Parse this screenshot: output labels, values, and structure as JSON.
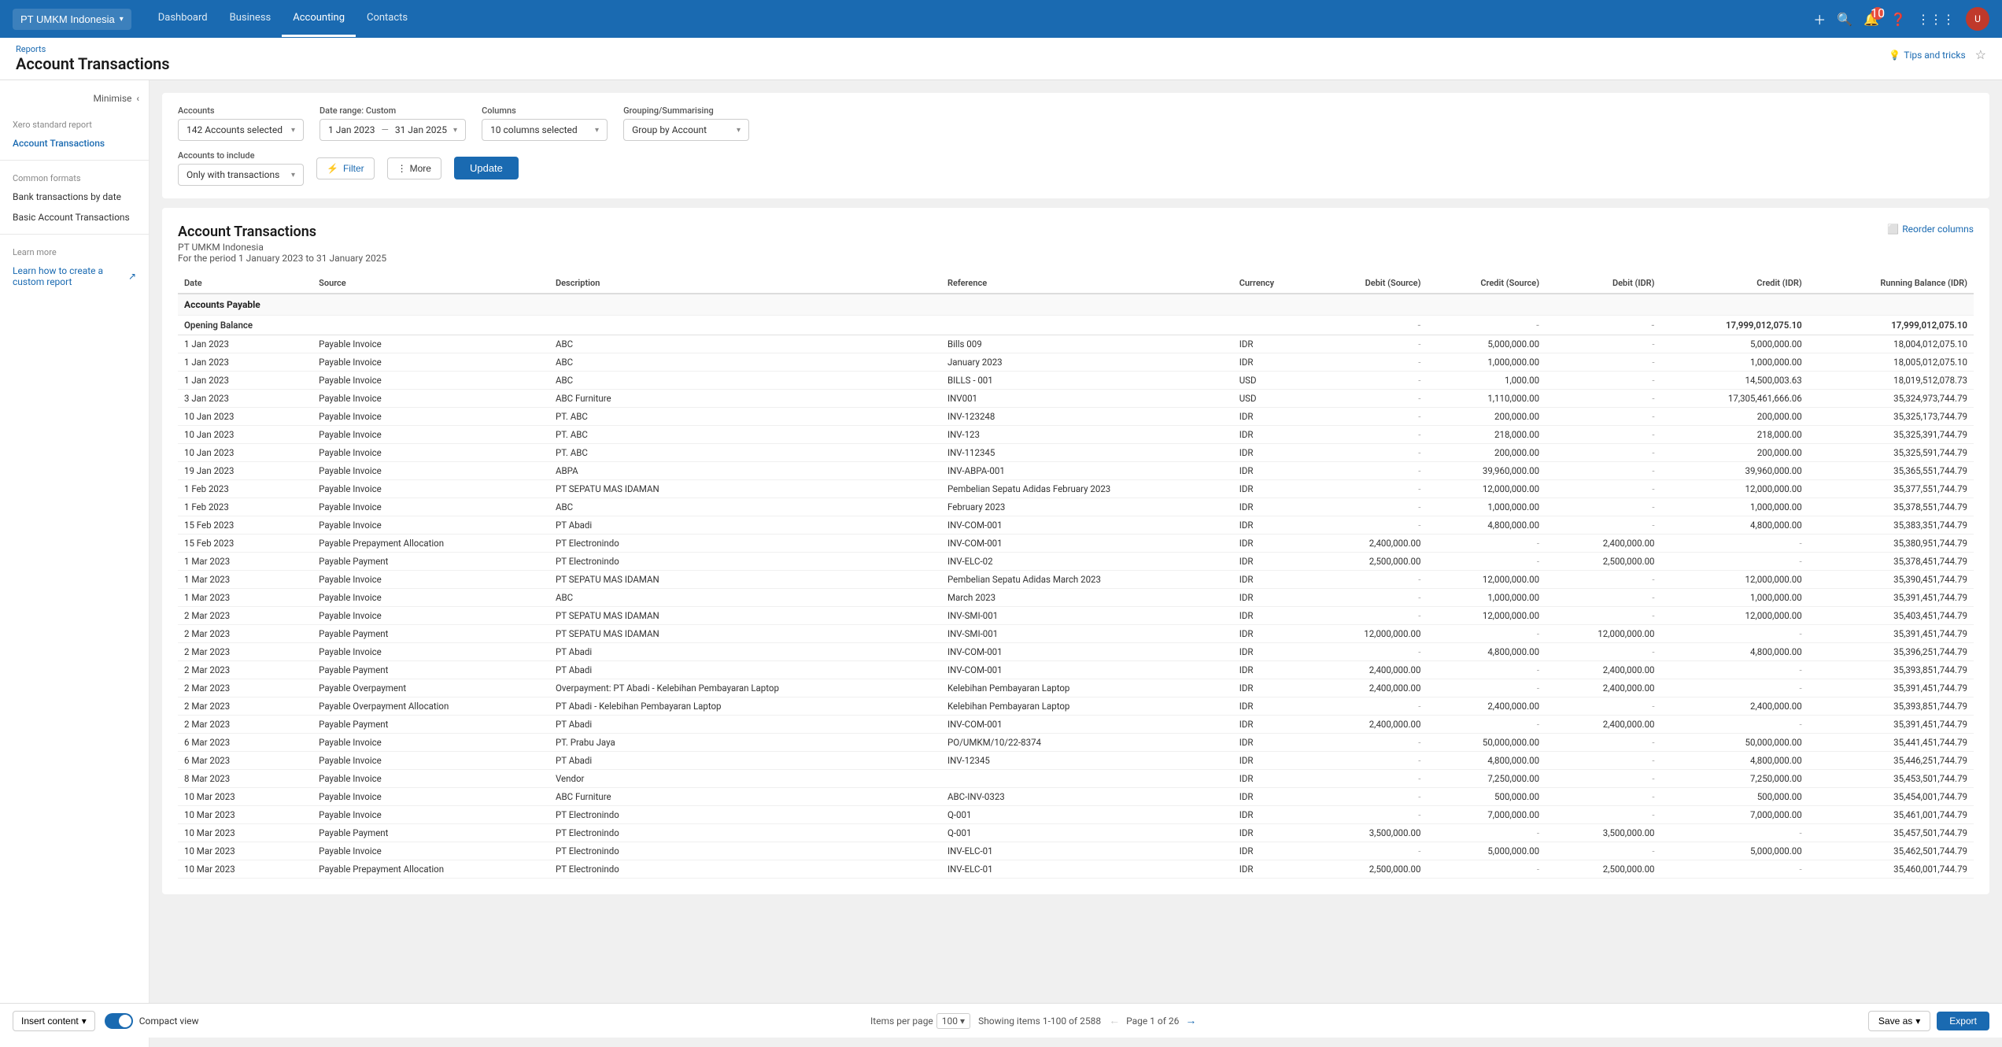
{
  "topNav": {
    "orgName": "PT UMKM Indonesia",
    "navLinks": [
      {
        "label": "Dashboard",
        "active": false
      },
      {
        "label": "Business",
        "active": false
      },
      {
        "label": "Accounting",
        "active": true
      },
      {
        "label": "Contacts",
        "active": false
      }
    ],
    "notificationCount": "10"
  },
  "pageHeader": {
    "breadcrumb": "Reports",
    "title": "Account Transactions",
    "tipsLabel": "Tips and tricks"
  },
  "sidebar": {
    "minimizeLabel": "Minimise",
    "xeroStandardLabel": "Xero standard report",
    "activeReport": "Account Transactions",
    "commonFormatsLabel": "Common formats",
    "commonFormats": [
      {
        "label": "Bank transactions by date"
      },
      {
        "label": "Basic Account Transactions"
      }
    ],
    "learnMoreLabel": "Learn more",
    "learnLink": "Learn how to create a custom report"
  },
  "filters": {
    "accountsLabel": "Accounts",
    "accountsValue": "142 Accounts selected",
    "dateRangeLabel": "Date range: Custom",
    "dateFrom": "1 Jan 2023",
    "dateTo": "31 Jan 2025",
    "columnsLabel": "Columns",
    "columnsValue": "10 columns selected",
    "groupingLabel": "Grouping/Summarising",
    "groupingValue": "Group by Account",
    "accountsToIncludeLabel": "Accounts to include",
    "includeValue": "Only with transactions",
    "filterBtnLabel": "Filter",
    "moreBtnLabel": "More",
    "updateBtnLabel": "Update"
  },
  "report": {
    "title": "Account Transactions",
    "company": "PT UMKM Indonesia",
    "periodLabel": "For the period 1 January 2023 to 31 January 2025",
    "reorderLabel": "Reorder columns",
    "columns": [
      "Date",
      "Source",
      "Description",
      "Reference",
      "Currency",
      "Debit (Source)",
      "Credit (Source)",
      "Debit (IDR)",
      "Credit (IDR)",
      "Running Balance (IDR)"
    ],
    "sections": [
      {
        "name": "Accounts Payable",
        "subHeaders": [
          "Opening Balance"
        ],
        "openingValues": [
          "-",
          "-",
          "-",
          "17,999,012,075.10",
          "17,999,012,075.10"
        ],
        "rows": [
          [
            "1 Jan 2023",
            "Payable Invoice",
            "ABC",
            "Bills 009",
            "IDR",
            "-",
            "5,000,000.00",
            "-",
            "5,000,000.00",
            "18,004,012,075.10"
          ],
          [
            "1 Jan 2023",
            "Payable Invoice",
            "ABC",
            "January 2023",
            "IDR",
            "-",
            "1,000,000.00",
            "-",
            "1,000,000.00",
            "18,005,012,075.10"
          ],
          [
            "1 Jan 2023",
            "Payable Invoice",
            "ABC",
            "BILLS - 001",
            "USD",
            "-",
            "1,000.00",
            "-",
            "14,500,003.63",
            "18,019,512,078.73"
          ],
          [
            "3 Jan 2023",
            "Payable Invoice",
            "ABC Furniture",
            "INV001",
            "USD",
            "-",
            "1,110,000.00",
            "-",
            "17,305,461,666.06",
            "35,324,973,744.79"
          ],
          [
            "10 Jan 2023",
            "Payable Invoice",
            "PT. ABC",
            "INV-123248",
            "IDR",
            "-",
            "200,000.00",
            "-",
            "200,000.00",
            "35,325,173,744.79"
          ],
          [
            "10 Jan 2023",
            "Payable Invoice",
            "PT. ABC",
            "INV-123",
            "IDR",
            "-",
            "218,000.00",
            "-",
            "218,000.00",
            "35,325,391,744.79"
          ],
          [
            "10 Jan 2023",
            "Payable Invoice",
            "PT. ABC",
            "INV-112345",
            "IDR",
            "-",
            "200,000.00",
            "-",
            "200,000.00",
            "35,325,591,744.79"
          ],
          [
            "19 Jan 2023",
            "Payable Invoice",
            "ABPA",
            "INV-ABPA-001",
            "IDR",
            "-",
            "39,960,000.00",
            "-",
            "39,960,000.00",
            "35,365,551,744.79"
          ],
          [
            "1 Feb 2023",
            "Payable Invoice",
            "PT SEPATU MAS IDAMAN",
            "Pembelian Sepatu Adidas February 2023",
            "IDR",
            "-",
            "12,000,000.00",
            "-",
            "12,000,000.00",
            "35,377,551,744.79"
          ],
          [
            "1 Feb 2023",
            "Payable Invoice",
            "ABC",
            "February 2023",
            "IDR",
            "-",
            "1,000,000.00",
            "-",
            "1,000,000.00",
            "35,378,551,744.79"
          ],
          [
            "15 Feb 2023",
            "Payable Invoice",
            "PT Abadi",
            "INV-COM-001",
            "IDR",
            "-",
            "4,800,000.00",
            "-",
            "4,800,000.00",
            "35,383,351,744.79"
          ],
          [
            "15 Feb 2023",
            "Payable Prepayment Allocation",
            "PT Electronindo",
            "INV-COM-001",
            "IDR",
            "2,400,000.00",
            "-",
            "2,400,000.00",
            "-",
            "35,380,951,744.79"
          ],
          [
            "1 Mar 2023",
            "Payable Payment",
            "PT Electronindo",
            "INV-ELC-02",
            "IDR",
            "2,500,000.00",
            "-",
            "2,500,000.00",
            "-",
            "35,378,451,744.79"
          ],
          [
            "1 Mar 2023",
            "Payable Invoice",
            "PT SEPATU MAS IDAMAN",
            "Pembelian Sepatu Adidas March 2023",
            "IDR",
            "-",
            "12,000,000.00",
            "-",
            "12,000,000.00",
            "35,390,451,744.79"
          ],
          [
            "1 Mar 2023",
            "Payable Invoice",
            "ABC",
            "March 2023",
            "IDR",
            "-",
            "1,000,000.00",
            "-",
            "1,000,000.00",
            "35,391,451,744.79"
          ],
          [
            "2 Mar 2023",
            "Payable Invoice",
            "PT SEPATU MAS IDAMAN",
            "INV-SMI-001",
            "IDR",
            "-",
            "12,000,000.00",
            "-",
            "12,000,000.00",
            "35,403,451,744.79"
          ],
          [
            "2 Mar 2023",
            "Payable Payment",
            "PT SEPATU MAS IDAMAN",
            "INV-SMI-001",
            "IDR",
            "12,000,000.00",
            "-",
            "12,000,000.00",
            "-",
            "35,391,451,744.79"
          ],
          [
            "2 Mar 2023",
            "Payable Invoice",
            "PT Abadi",
            "INV-COM-001",
            "IDR",
            "-",
            "4,800,000.00",
            "-",
            "4,800,000.00",
            "35,396,251,744.79"
          ],
          [
            "2 Mar 2023",
            "Payable Payment",
            "PT Abadi",
            "INV-COM-001",
            "IDR",
            "2,400,000.00",
            "-",
            "2,400,000.00",
            "-",
            "35,393,851,744.79"
          ],
          [
            "2 Mar 2023",
            "Payable Overpayment",
            "Overpayment: PT Abadi - Kelebihan Pembayaran Laptop",
            "Kelebihan Pembayaran Laptop",
            "IDR",
            "2,400,000.00",
            "-",
            "2,400,000.00",
            "-",
            "35,391,451,744.79"
          ],
          [
            "2 Mar 2023",
            "Payable Overpayment Allocation",
            "PT Abadi - Kelebihan Pembayaran Laptop",
            "Kelebihan Pembayaran Laptop",
            "IDR",
            "-",
            "2,400,000.00",
            "-",
            "2,400,000.00",
            "35,393,851,744.79"
          ],
          [
            "2 Mar 2023",
            "Payable Payment",
            "PT Abadi",
            "INV-COM-001",
            "IDR",
            "2,400,000.00",
            "-",
            "2,400,000.00",
            "-",
            "35,391,451,744.79"
          ],
          [
            "6 Mar 2023",
            "Payable Invoice",
            "PT. Prabu Jaya",
            "PO/UMKM/10/22-8374",
            "IDR",
            "-",
            "50,000,000.00",
            "-",
            "50,000,000.00",
            "35,441,451,744.79"
          ],
          [
            "6 Mar 2023",
            "Payable Invoice",
            "PT Abadi",
            "INV-12345",
            "IDR",
            "-",
            "4,800,000.00",
            "-",
            "4,800,000.00",
            "35,446,251,744.79"
          ],
          [
            "8 Mar 2023",
            "Payable Invoice",
            "Vendor",
            "",
            "IDR",
            "-",
            "7,250,000.00",
            "-",
            "7,250,000.00",
            "35,453,501,744.79"
          ],
          [
            "10 Mar 2023",
            "Payable Invoice",
            "ABC Furniture",
            "ABC-INV-0323",
            "IDR",
            "-",
            "500,000.00",
            "-",
            "500,000.00",
            "35,454,001,744.79"
          ],
          [
            "10 Mar 2023",
            "Payable Invoice",
            "PT Electronindo",
            "Q-001",
            "IDR",
            "-",
            "7,000,000.00",
            "-",
            "7,000,000.00",
            "35,461,001,744.79"
          ],
          [
            "10 Mar 2023",
            "Payable Payment",
            "PT Electronindo",
            "Q-001",
            "IDR",
            "3,500,000.00",
            "-",
            "3,500,000.00",
            "-",
            "35,457,501,744.79"
          ],
          [
            "10 Mar 2023",
            "Payable Invoice",
            "PT Electronindo",
            "INV-ELC-01",
            "IDR",
            "-",
            "5,000,000.00",
            "-",
            "5,000,000.00",
            "35,462,501,744.79"
          ],
          [
            "10 Mar 2023",
            "Payable Prepayment Allocation",
            "PT Electronindo",
            "INV-ELC-01",
            "IDR",
            "2,500,000.00",
            "-",
            "2,500,000.00",
            "-",
            "35,460,001,744.79"
          ]
        ]
      }
    ]
  },
  "footer": {
    "insertContentLabel": "Insert content",
    "compactViewLabel": "Compact view",
    "itemsPerPageLabel": "Items per page",
    "perPageValue": "100",
    "showingLabel": "Showing items 1-100 of 2588",
    "pageLabel": "Page 1 of 26",
    "saveAsLabel": "Save as",
    "exportLabel": "Export"
  }
}
